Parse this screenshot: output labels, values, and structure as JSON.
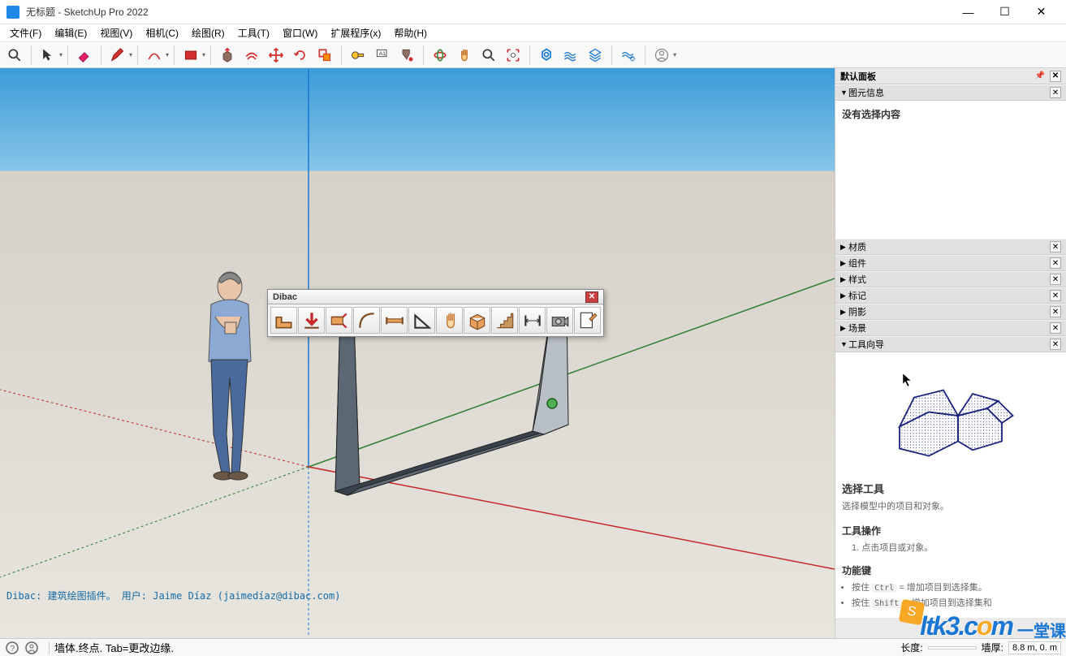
{
  "window": {
    "title": "无标题 - SketchUp Pro 2022",
    "min": "—",
    "max": "☐",
    "close": "✕"
  },
  "menu": {
    "items": [
      "文件(F)",
      "编辑(E)",
      "视图(V)",
      "相机(C)",
      "绘图(R)",
      "工具(T)",
      "窗口(W)",
      "扩展程序(x)",
      "帮助(H)"
    ]
  },
  "sidepanel": {
    "main_title": "默认面板",
    "pin": "⏷",
    "sections": {
      "entity": {
        "label": "图元信息",
        "body": "没有选择内容",
        "expanded": true
      },
      "materials": {
        "label": "材质"
      },
      "components": {
        "label": "组件"
      },
      "styles": {
        "label": "样式"
      },
      "tags": {
        "label": "标记"
      },
      "shadows": {
        "label": "阴影"
      },
      "scenes": {
        "label": "场景"
      },
      "guide": {
        "label": "工具向导",
        "expanded": true
      }
    },
    "guide": {
      "title": "选择工具",
      "desc": "选择模型中的项目和对象。",
      "op_title": "工具操作",
      "op_1": "1. 点击项目或对象。",
      "keys_title": "功能键",
      "key_1_prefix": "按住 ",
      "key_1_code": "Ctrl",
      "key_1_suffix": " = 增加项目到选择集。",
      "key_2_prefix": "按住 ",
      "key_2_code": "Shift",
      "key_2_suffix": " = 增加项目到选择集和"
    }
  },
  "float_toolbar": {
    "title": "Dibac"
  },
  "infobar": "Dibac: 建筑绘图插件。 用户: Jaime Díaz (jaimedíaz@dibac.com)",
  "statusbar": {
    "hint": "墙体.终点. Tab=更改边缘.",
    "length_label": "长度:",
    "length_value": "",
    "thick_label": "墙厚:",
    "thick_value": "8.8 m, 0. m"
  },
  "watermark": {
    "logo_prefix": "ltk3",
    "logo_suffix": ".c",
    "logo_o": "o",
    "logo_m": "m",
    "sub": "一堂课"
  }
}
